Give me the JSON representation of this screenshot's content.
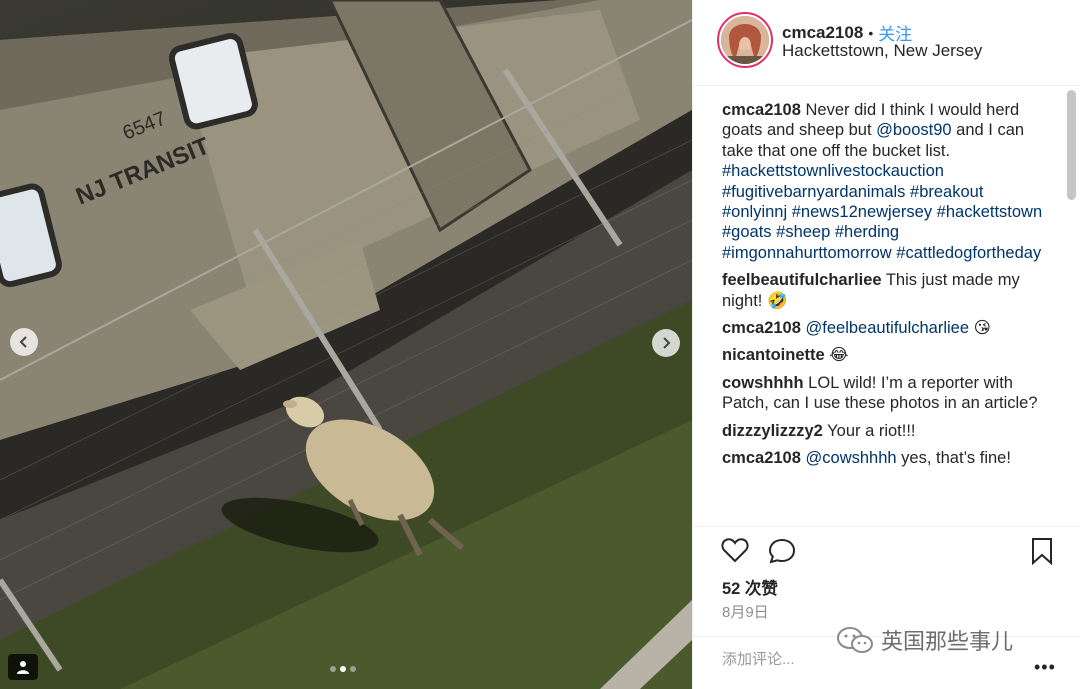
{
  "post": {
    "username": "cmca2108",
    "separator": "•",
    "follow_label": "关注",
    "location": "Hackettstown, New Jersey"
  },
  "photo": {
    "train_number": "6547",
    "train_brand": "NJ TRANSIT",
    "carousel_dots": 3,
    "carousel_active": 2
  },
  "comments": [
    {
      "user": "cmca2108",
      "parts": [
        {
          "t": "text",
          "v": " Never did I think I would herd goats and sheep but "
        },
        {
          "t": "tag",
          "v": "@boost90"
        },
        {
          "t": "text",
          "v": " and I can take that one off the bucket list. "
        },
        {
          "t": "tag",
          "v": "#hackettstownlivestockauction"
        },
        {
          "t": "text",
          "v": " "
        },
        {
          "t": "tag",
          "v": "#fugitivebarnyardanimals"
        },
        {
          "t": "text",
          "v": " "
        },
        {
          "t": "tag",
          "v": "#breakout"
        },
        {
          "t": "text",
          "v": " "
        },
        {
          "t": "tag",
          "v": "#onlyinnj"
        },
        {
          "t": "text",
          "v": " "
        },
        {
          "t": "tag",
          "v": "#news12newjersey"
        },
        {
          "t": "text",
          "v": " "
        },
        {
          "t": "tag",
          "v": "#hackettstown"
        },
        {
          "t": "text",
          "v": " "
        },
        {
          "t": "tag",
          "v": "#goats"
        },
        {
          "t": "text",
          "v": " "
        },
        {
          "t": "tag",
          "v": "#sheep"
        },
        {
          "t": "text",
          "v": " "
        },
        {
          "t": "tag",
          "v": "#herding"
        },
        {
          "t": "text",
          "v": " "
        },
        {
          "t": "tag",
          "v": "#imgonnahurttomorrow"
        },
        {
          "t": "text",
          "v": " "
        },
        {
          "t": "tag",
          "v": "#cattledogfortheday"
        }
      ]
    },
    {
      "user": "feelbeautifulcharliee",
      "parts": [
        {
          "t": "text",
          "v": " This just made my night! "
        },
        {
          "t": "emoji",
          "v": "🤣"
        }
      ]
    },
    {
      "user": "cmca2108",
      "parts": [
        {
          "t": "text",
          "v": " "
        },
        {
          "t": "tag",
          "v": "@feelbeautifulcharliee"
        },
        {
          "t": "text",
          "v": " "
        },
        {
          "t": "emoji",
          "v": "😘"
        }
      ]
    },
    {
      "user": "nicantoinette",
      "parts": [
        {
          "t": "text",
          "v": " "
        },
        {
          "t": "emoji",
          "v": "😂"
        }
      ]
    },
    {
      "user": "cowshhhh",
      "parts": [
        {
          "t": "text",
          "v": " LOL wild! I’m a reporter with Patch, can I use these photos in an article?"
        }
      ]
    },
    {
      "user": "dizzzylizzzy2",
      "parts": [
        {
          "t": "text",
          "v": " Your a riot!!!"
        }
      ]
    },
    {
      "user": "cmca2108",
      "parts": [
        {
          "t": "text",
          "v": " "
        },
        {
          "t": "tag",
          "v": "@cowshhhh"
        },
        {
          "t": "text",
          "v": " yes, that’s fine!"
        }
      ]
    }
  ],
  "actions": {
    "likes": "52 次赞",
    "date": "8月9日"
  },
  "add_comment": {
    "placeholder": "添加评论...",
    "more_label": "•••"
  },
  "watermark": {
    "text": "英国那些事儿"
  },
  "colors": {
    "accent_link": "#3897f0",
    "hashtag": "#003569",
    "avatar_ring": "#e1306c",
    "muted": "#8e8e8e"
  }
}
